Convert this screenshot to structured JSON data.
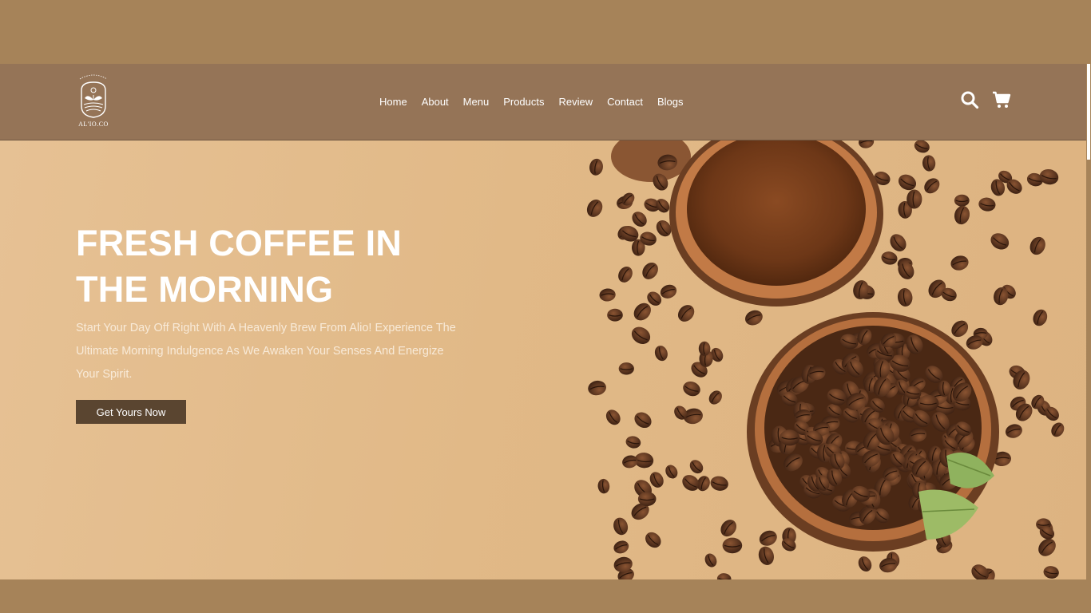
{
  "brand": {
    "logo_text": "AL'IO.CO"
  },
  "nav": {
    "items": [
      {
        "label": "Home"
      },
      {
        "label": "About"
      },
      {
        "label": "Menu"
      },
      {
        "label": "Products"
      },
      {
        "label": "Review"
      },
      {
        "label": "Contact"
      },
      {
        "label": "Blogs"
      }
    ]
  },
  "header_icons": {
    "search": "search-icon",
    "cart": "cart-icon"
  },
  "hero": {
    "title_line1": "FRESH COFFEE IN",
    "title_line2": "THE MORNING",
    "description": "Start Your Day Off Right With A Heavenly Brew From Alio! Experience The Ultimate Morning Indulgence As We Awaken Your Senses And Energize Your Spirit.",
    "cta_label": "Get Yours Now"
  },
  "colors": {
    "page_background": "#a68359",
    "header_background": "#957457",
    "hero_background": "#e1b987",
    "button_background": "#5a4530",
    "text_light": "#ffffff"
  }
}
